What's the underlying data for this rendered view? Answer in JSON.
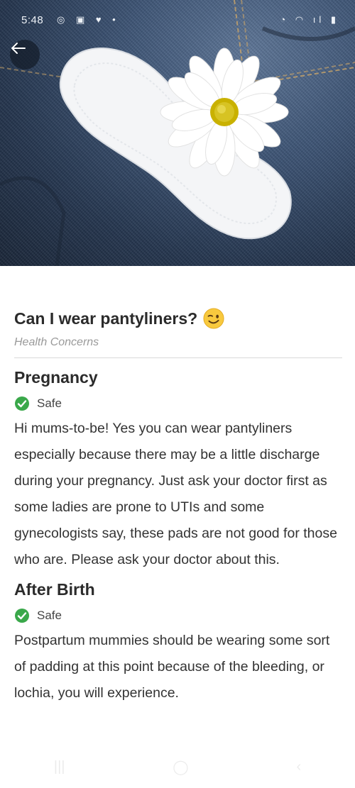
{
  "status_bar": {
    "time": "5:48",
    "left_icons": "◎ ▣ ♥ •",
    "right_icons": "◔ ◠ ıl ▮"
  },
  "hero": {
    "icon": "back-arrow-icon"
  },
  "article": {
    "title": "Can I wear pantyliners?",
    "title_emoji": "winking-face",
    "category": "Health Concerns",
    "sections": [
      {
        "heading": "Pregnancy",
        "status": "Safe",
        "status_color": "#3aa84a",
        "text": "Hi mums-to-be! Yes you can wear pantyliners especially because there may be a little discharge during your pregnancy. Just ask your doctor first as some ladies are prone to UTIs and some gynecologists say, these pads are not good for those who are. Please ask your doctor about this."
      },
      {
        "heading": "After Birth",
        "status": "Safe",
        "status_color": "#3aa84a",
        "text": "Postpartum mummies should be wearing some sort of padding at this point because of the bleeding, or lochia, you will experience."
      }
    ]
  },
  "nav_bar": {
    "recents": "|||",
    "home": "◯",
    "back": "‹"
  }
}
